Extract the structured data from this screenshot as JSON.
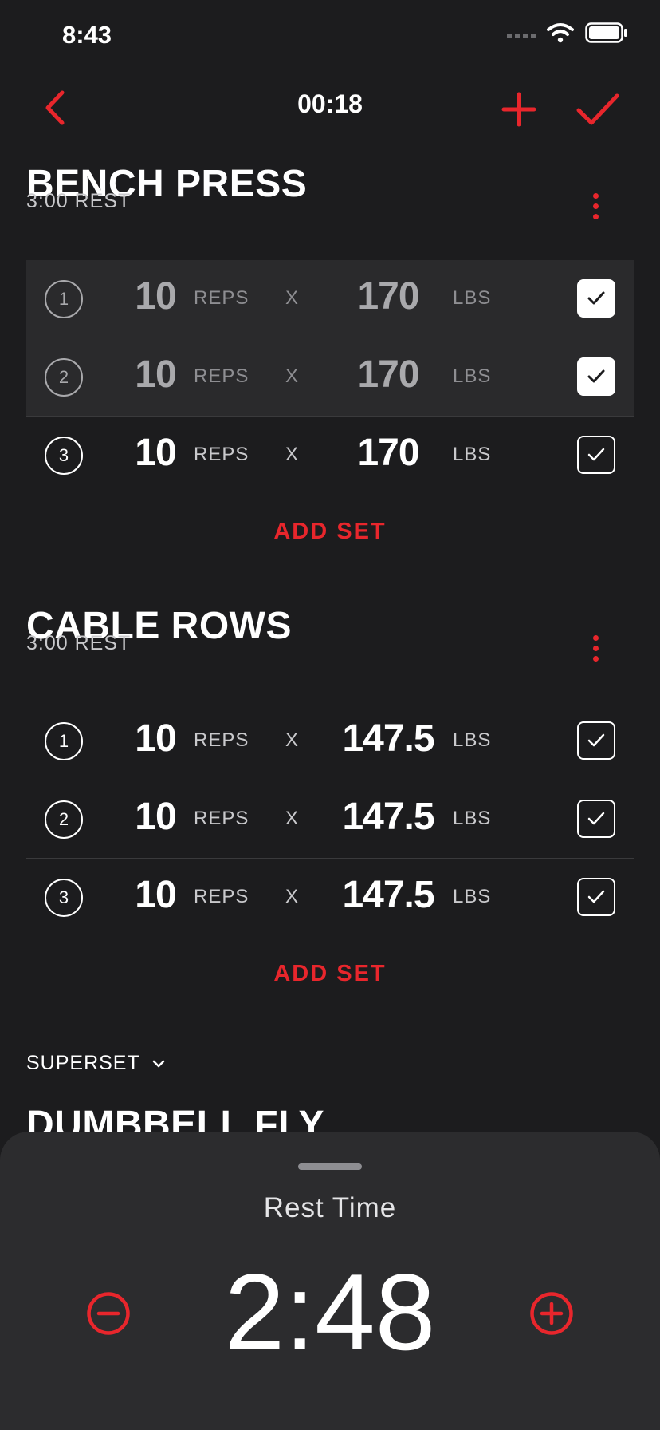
{
  "status_bar": {
    "time": "8:43"
  },
  "nav": {
    "timer": "00:18"
  },
  "colors": {
    "accent": "#e8262c",
    "background": "#1c1c1e",
    "sheet": "#2c2c2e"
  },
  "exercises": [
    {
      "title": "BENCH PRESS",
      "rest": "3:00 REST",
      "add_set_label": "ADD SET",
      "sets": [
        {
          "number": "1",
          "reps": "10",
          "reps_unit": "REPS",
          "x": "X",
          "weight": "170",
          "weight_unit": "LBS",
          "completed": true
        },
        {
          "number": "2",
          "reps": "10",
          "reps_unit": "REPS",
          "x": "X",
          "weight": "170",
          "weight_unit": "LBS",
          "completed": true
        },
        {
          "number": "3",
          "reps": "10",
          "reps_unit": "REPS",
          "x": "X",
          "weight": "170",
          "weight_unit": "LBS",
          "completed": false
        }
      ]
    },
    {
      "title": "CABLE ROWS",
      "rest": "3:00 REST",
      "add_set_label": "ADD SET",
      "sets": [
        {
          "number": "1",
          "reps": "10",
          "reps_unit": "REPS",
          "x": "X",
          "weight": "147.5",
          "weight_unit": "LBS",
          "completed": false
        },
        {
          "number": "2",
          "reps": "10",
          "reps_unit": "REPS",
          "x": "X",
          "weight": "147.5",
          "weight_unit": "LBS",
          "completed": false
        },
        {
          "number": "3",
          "reps": "10",
          "reps_unit": "REPS",
          "x": "X",
          "weight": "147.5",
          "weight_unit": "LBS",
          "completed": false
        }
      ]
    }
  ],
  "superset": {
    "label": "SUPERSET"
  },
  "next_exercise": {
    "title": "DUMBBELL FLY"
  },
  "rest_sheet": {
    "label": "Rest Time",
    "value": "2:48"
  },
  "icons": {
    "back": "chevron-left-icon",
    "add": "plus-icon",
    "done": "checkmark-icon",
    "menu": "more-vertical-icon",
    "check": "checkbox-icon",
    "minus": "minus-circle-icon",
    "plus": "plus-circle-icon"
  }
}
